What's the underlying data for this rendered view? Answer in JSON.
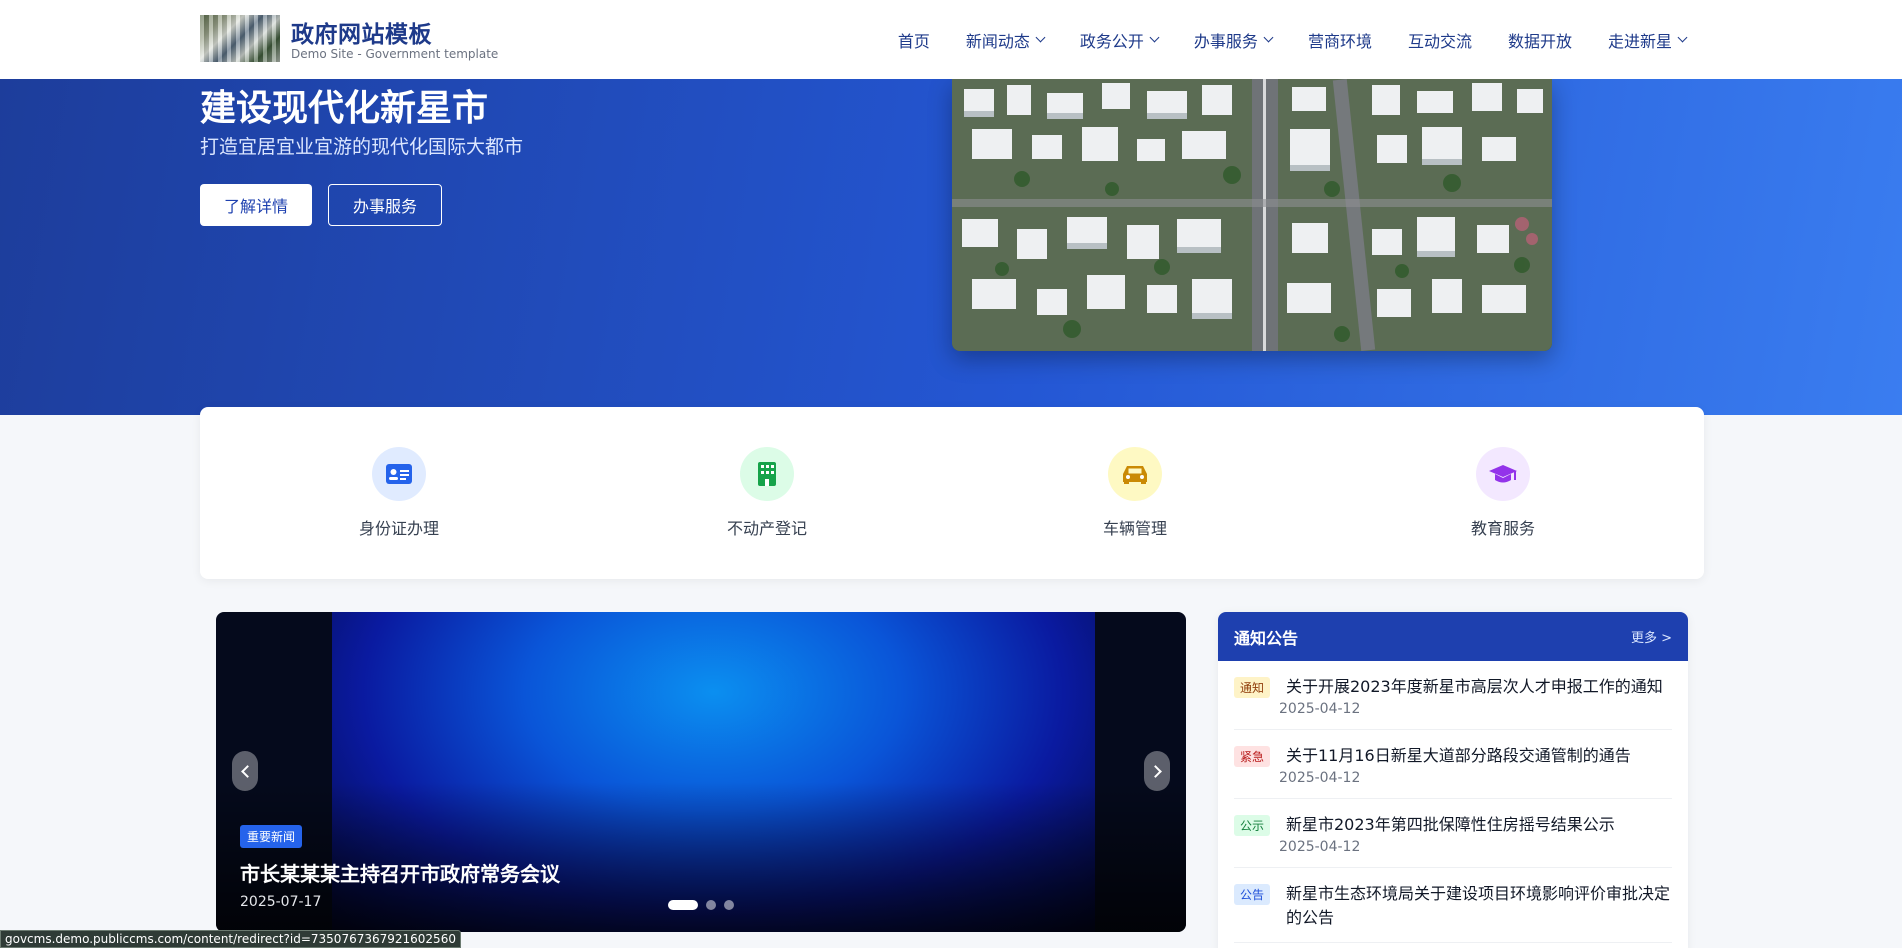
{
  "header": {
    "title": "政府网站模板",
    "subtitle": "Demo Site - Government template",
    "nav": [
      {
        "label": "首页",
        "dropdown": false
      },
      {
        "label": "新闻动态",
        "dropdown": true
      },
      {
        "label": "政务公开",
        "dropdown": true
      },
      {
        "label": "办事服务",
        "dropdown": true
      },
      {
        "label": "营商环境",
        "dropdown": false
      },
      {
        "label": "互动交流",
        "dropdown": false
      },
      {
        "label": "数据开放",
        "dropdown": false
      },
      {
        "label": "走进新星",
        "dropdown": true
      }
    ]
  },
  "hero": {
    "title": "建设现代化新星市",
    "subtitle": "打造宜居宜业宜游的现代化国际大都市",
    "primary_button": "了解详情",
    "secondary_button": "办事服务"
  },
  "services": [
    {
      "label": "身份证办理",
      "icon": "id-card-icon",
      "bg": "#e0ebff",
      "fg": "#2563eb"
    },
    {
      "label": "不动产登记",
      "icon": "building-icon",
      "bg": "#dcfce7",
      "fg": "#16a34a"
    },
    {
      "label": "车辆管理",
      "icon": "car-icon",
      "bg": "#fef9c3",
      "fg": "#ca8a04"
    },
    {
      "label": "教育服务",
      "icon": "graduation-cap-icon",
      "bg": "#f3e8ff",
      "fg": "#9333ea"
    }
  ],
  "carousel": {
    "tag": "重要新闻",
    "title": "市长某某某主持召开市政府常务会议",
    "date": "2025-07-17",
    "slide_count": 3,
    "active_slide": 1
  },
  "notices": {
    "title": "通知公告",
    "more": "更多 >",
    "items": [
      {
        "badge": "通知",
        "badge_bg": "#fef3c7",
        "badge_fg": "#92400e",
        "text": "关于开展2023年度新星市高层次人才申报工作的通知",
        "date": "2025-04-12"
      },
      {
        "badge": "紧急",
        "badge_bg": "#fee2e2",
        "badge_fg": "#b91c1c",
        "text": "关于11月16日新星大道部分路段交通管制的通告",
        "date": "2025-04-12"
      },
      {
        "badge": "公示",
        "badge_bg": "#dcfce7",
        "badge_fg": "#15803d",
        "text": "新星市2023年第四批保障性住房摇号结果公示",
        "date": "2025-04-12"
      },
      {
        "badge": "公告",
        "badge_bg": "#dbeafe",
        "badge_fg": "#1d4ed8",
        "text": "新星市生态环境局关于建设项目环境影响评价审批决定的公告",
        "date": ""
      }
    ]
  },
  "statusbar": {
    "url": "govcms.demo.publiccms.com/content/redirect?id=7350767367921602560"
  }
}
